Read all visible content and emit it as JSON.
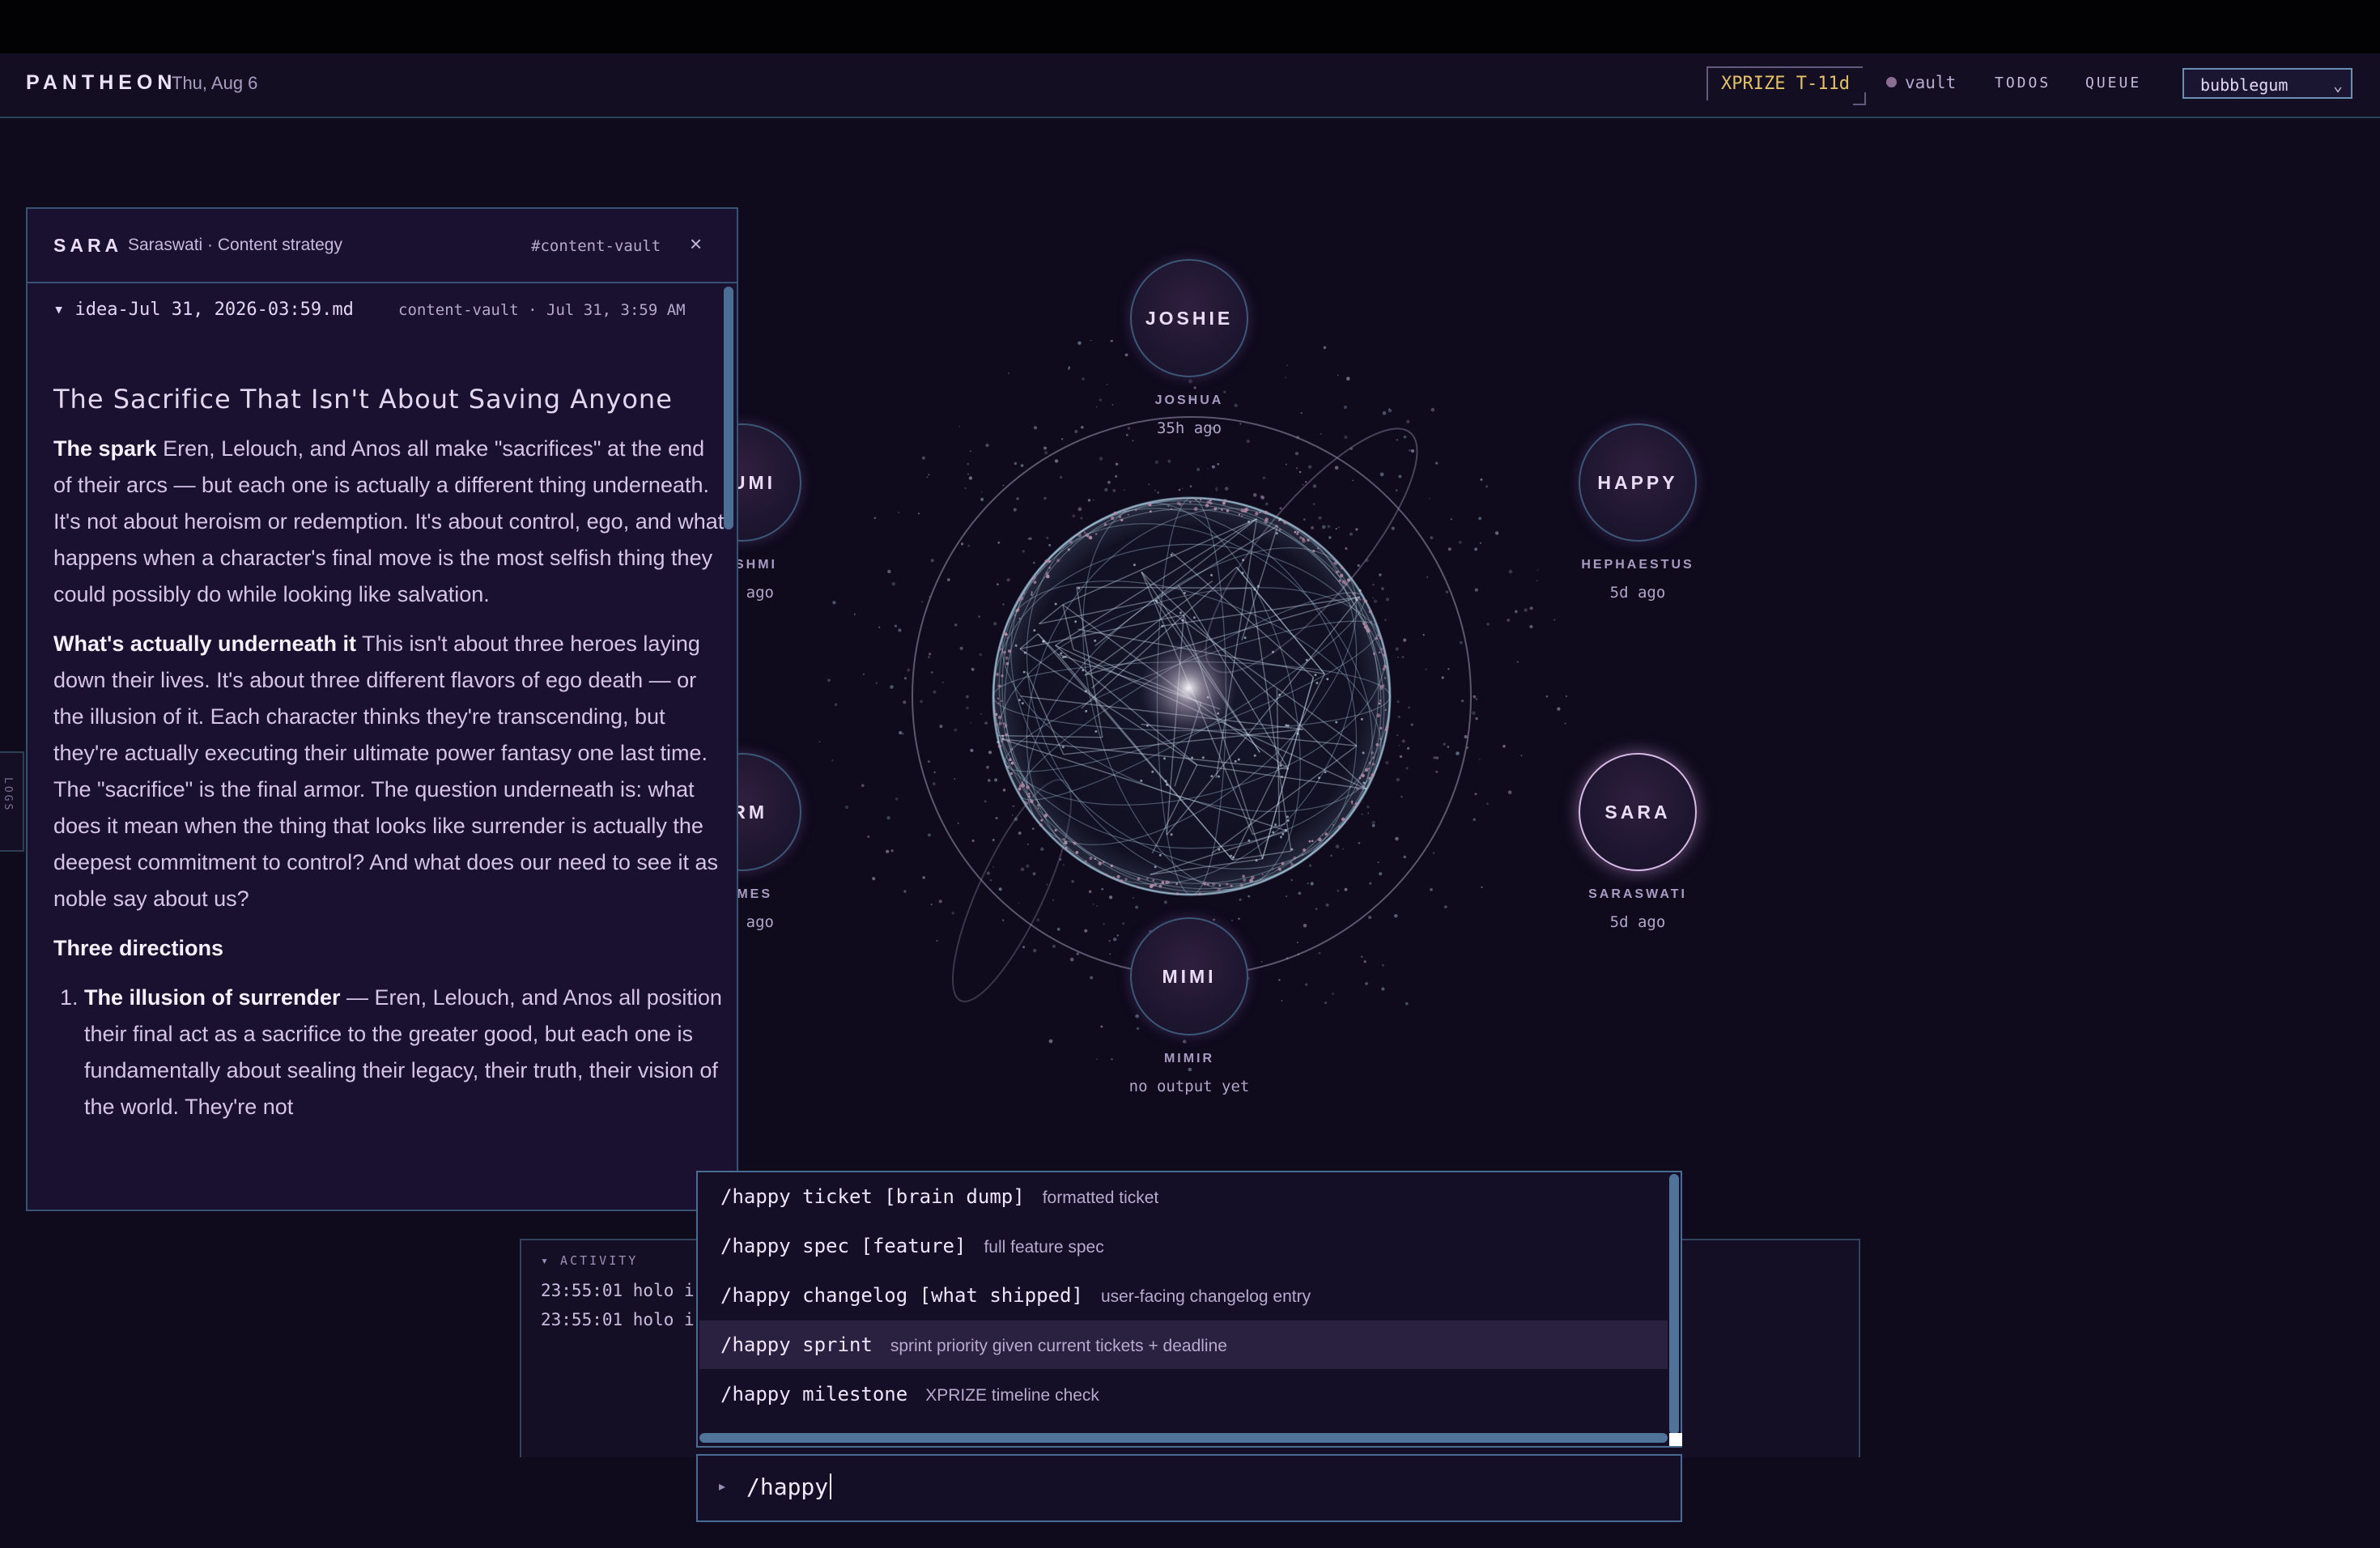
{
  "header": {
    "brand": "PANTHEON",
    "date": "Thu, Aug 6",
    "xprize": "XPRIZE T-11d",
    "vault": "vault",
    "todos": "TODOS",
    "queue": "QUEUE",
    "theme": "bubblegum"
  },
  "logs_tab": "LOGS",
  "agents": {
    "joshie": {
      "name": "JOSHIE",
      "full": "JOSHUA",
      "time": "35h ago"
    },
    "happy": {
      "name": "HAPPY",
      "full": "HEPHAESTUS",
      "time": "5d ago"
    },
    "sara": {
      "name": "SARA",
      "full": "SARASWATI",
      "time": "5d ago"
    },
    "mimi": {
      "name": "MIMI",
      "full": "MIMIR",
      "time": "no output yet"
    },
    "umi": {
      "name": "UMI",
      "full": "SHMI",
      "time": "ago"
    },
    "rm": {
      "name": "RM",
      "full": "MES",
      "time": "ago"
    }
  },
  "doc": {
    "agent": "SARA",
    "role": "Saraswati · Content strategy",
    "channel": "#content-vault",
    "close": "×",
    "file": "▾ idea-Jul 31, 2026-03:59.md",
    "file_meta": "content-vault · Jul 31, 3:59 AM",
    "title": "The Sacrifice That Isn't About Saving Anyone",
    "spark_label": "The spark",
    "spark_text": " Eren, Lelouch, and Anos all make \"sacrifices\" at the end of their arcs — but each one is actually a different thing underneath. It's not about heroism or redemption. It's about control, ego, and what happens when a character's final move is the most selfish thing they could possibly do while looking like salvation.",
    "under_label": "What's actually underneath it",
    "under_text": " This isn't about three heroes laying down their lives. It's about three different flavors of ego death — or the illusion of it. Each character thinks they're transcending, but they're actually executing their ultimate power fantasy one last time. The \"sacrifice\" is the final armor. The question underneath is: what does it mean when the thing that looks like surrender is actually the deepest commitment to control? And what does our need to see it as noble say about us?",
    "directions_label": "Three directions",
    "list_item_1_label": "The illusion of surrender",
    "list_item_1_text": " — Eren, Lelouch, and Anos all position their final act as a sacrifice to the greater good, but each one is fundamentally about sealing their legacy, their truth, their vision of the world. They're not"
  },
  "activity": {
    "label": "▾ ACTIVITY",
    "lines": [
      "23:55:01 holo i",
      "23:55:01 holo i"
    ]
  },
  "suggestions": [
    {
      "cmd": "/happy ticket [brain dump]",
      "desc": "formatted ticket"
    },
    {
      "cmd": "/happy spec [feature]",
      "desc": "full feature spec"
    },
    {
      "cmd": "/happy changelog [what shipped]",
      "desc": "user-facing changelog entry"
    },
    {
      "cmd": "/happy sprint",
      "desc": "sprint priority given current tickets + deadline"
    },
    {
      "cmd": "/happy milestone",
      "desc": "XPRIZE timeline check"
    }
  ],
  "input": {
    "prompt": "▸",
    "value": "/happy"
  },
  "colors": {
    "background": "#0f0a1c",
    "accent_gold": "#e4c167",
    "border_blue": "#4a6c94",
    "active_node": "#d9b9e6"
  }
}
